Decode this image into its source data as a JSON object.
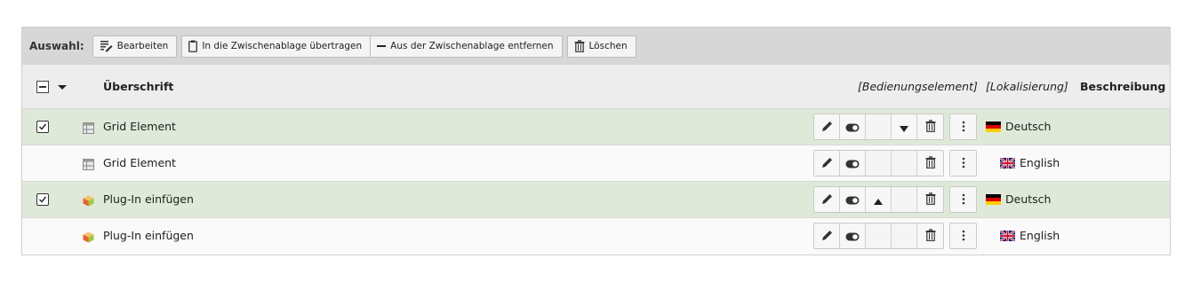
{
  "selection_bar": {
    "label": "Auswahl:",
    "buttons": [
      {
        "label": "Bearbeiten",
        "icon": "edit-list-icon"
      },
      {
        "label": "In die Zwischenablage übertragen",
        "icon": "clipboard-icon"
      },
      {
        "label": "Aus der Zwischenablage entfernen",
        "icon": "minus-icon"
      },
      {
        "label": "Löschen",
        "icon": "trash-icon"
      }
    ]
  },
  "table": {
    "headers": {
      "title": "Überschrift",
      "control": "[Bedienungselement]",
      "localization": "[Lokalisierung]",
      "description": "Beschreibung"
    },
    "rows": [
      {
        "checked": true,
        "title": "Grid Element",
        "type_icon": "grid-element-icon",
        "move": "down",
        "language": "Deutsch",
        "flag": "de-flag-icon"
      },
      {
        "checked": false,
        "title": "Grid Element",
        "type_icon": "grid-element-icon",
        "move": "none",
        "language": "English",
        "flag": "uk-flag-icon"
      },
      {
        "checked": true,
        "title": "Plug-In einfügen",
        "type_icon": "plugin-icon",
        "move": "up",
        "language": "Deutsch",
        "flag": "de-flag-icon"
      },
      {
        "checked": false,
        "title": "Plug-In einfügen",
        "type_icon": "plugin-icon",
        "move": "none",
        "language": "English",
        "flag": "uk-flag-icon"
      }
    ]
  },
  "colors": {
    "selected_row": "#dfe9d9",
    "header_bg": "#ededed",
    "selection_bar_bg": "#d7d7d7",
    "plugin_icon": "#f39c12"
  }
}
